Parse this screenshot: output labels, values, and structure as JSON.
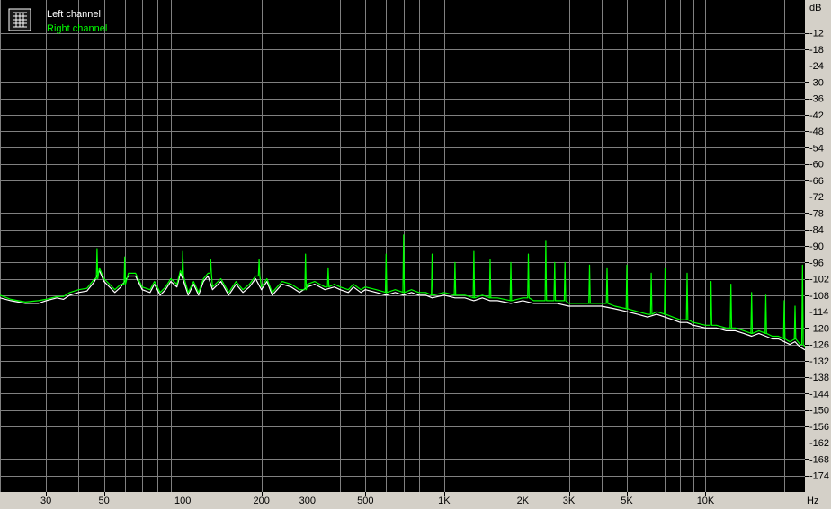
{
  "chart_data": {
    "type": "line",
    "title": "",
    "xlabel": "",
    "ylabel": "",
    "x_unit": "Hz",
    "y_unit": "dB",
    "x_scale": "log",
    "xlim": [
      20,
      24000
    ],
    "ylim": [
      -180,
      0
    ],
    "grid": true,
    "legend_placement": "top-left",
    "background": "#000000",
    "grid_color": "#808080",
    "x_ticks": [
      {
        "value": 30,
        "label": "30"
      },
      {
        "value": 50,
        "label": "50"
      },
      {
        "value": 100,
        "label": "100"
      },
      {
        "value": 200,
        "label": "200"
      },
      {
        "value": 300,
        "label": "300"
      },
      {
        "value": 500,
        "label": "500"
      },
      {
        "value": 1000,
        "label": "1K"
      },
      {
        "value": 2000,
        "label": "2K"
      },
      {
        "value": 3000,
        "label": "3K"
      },
      {
        "value": 5000,
        "label": "5K"
      },
      {
        "value": 10000,
        "label": "10K"
      }
    ],
    "y_ticks": [
      -12,
      -18,
      -24,
      -30,
      -36,
      -42,
      -48,
      -54,
      -60,
      -66,
      -72,
      -78,
      -84,
      -90,
      -96,
      -102,
      -108,
      -114,
      -120,
      -126,
      -132,
      -138,
      -144,
      -150,
      -156,
      -162,
      -168,
      -174
    ],
    "series": [
      {
        "name": "Left channel",
        "color": "#ffffff",
        "x": [
          20,
          22,
          25,
          28,
          30,
          33,
          35,
          37,
          40,
          43,
          46,
          48,
          50,
          55,
          58,
          62,
          66,
          70,
          75,
          78,
          82,
          86,
          90,
          95,
          98,
          100,
          105,
          110,
          115,
          120,
          125,
          130,
          140,
          150,
          160,
          170,
          180,
          190,
          200,
          210,
          220,
          240,
          260,
          280,
          300,
          320,
          350,
          380,
          400,
          430,
          450,
          480,
          500,
          550,
          600,
          650,
          700,
          750,
          800,
          850,
          900,
          1000,
          1100,
          1200,
          1300,
          1400,
          1500,
          1600,
          1800,
          2000,
          2200,
          2500,
          2700,
          3000,
          3300,
          3600,
          4000,
          4500,
          5000,
          5500,
          6000,
          6500,
          7000,
          7500,
          8000,
          8500,
          9000,
          10000,
          11000,
          12000,
          13000,
          14000,
          15000,
          16000,
          17000,
          18000,
          19000,
          20000,
          21000,
          22000,
          23000,
          24000
        ],
        "y": [
          -109,
          -110,
          -111,
          -111,
          -110,
          -109,
          -109.5,
          -108,
          -107,
          -106.5,
          -103,
          -99,
          -103,
          -107,
          -105,
          -101,
          -101,
          -106,
          -107,
          -104,
          -108,
          -106,
          -103,
          -105,
          -100,
          -102,
          -108,
          -104,
          -108,
          -103,
          -101,
          -106,
          -103,
          -108,
          -104,
          -107,
          -105,
          -102,
          -106,
          -103,
          -108,
          -104,
          -105,
          -107,
          -105,
          -104,
          -106,
          -105,
          -106,
          -107,
          -105,
          -107,
          -106,
          -107,
          -108,
          -107,
          -108,
          -107,
          -108,
          -108,
          -109,
          -108,
          -109,
          -109,
          -110,
          -109,
          -110,
          -110,
          -111,
          -110,
          -111,
          -111,
          -111,
          -112,
          -112,
          -112,
          -112,
          -113,
          -114,
          -115,
          -116,
          -115,
          -116,
          -117,
          -118,
          -118,
          -119,
          -120,
          -120,
          -121,
          -121,
          -122,
          -123,
          -122,
          -123,
          -124,
          -124,
          -125,
          -126,
          -125,
          -127,
          -128
        ]
      },
      {
        "name": "Right channel",
        "color": "#00ff00",
        "x": [
          20,
          22,
          25,
          28,
          30,
          33,
          35,
          37,
          40,
          43,
          46,
          48,
          50,
          55,
          58,
          62,
          66,
          70,
          75,
          78,
          82,
          86,
          90,
          95,
          98,
          100,
          105,
          110,
          115,
          120,
          125,
          130,
          140,
          150,
          160,
          170,
          180,
          190,
          200,
          210,
          220,
          240,
          260,
          280,
          300,
          320,
          350,
          380,
          400,
          430,
          450,
          480,
          500,
          550,
          600,
          650,
          700,
          750,
          800,
          850,
          900,
          1000,
          1100,
          1200,
          1300,
          1400,
          1500,
          1600,
          1800,
          2000,
          2200,
          2500,
          2700,
          3000,
          3300,
          3600,
          4000,
          4500,
          5000,
          5500,
          6000,
          6500,
          7000,
          7500,
          8000,
          8500,
          9000,
          10000,
          11000,
          12000,
          13000,
          14000,
          15000,
          16000,
          17000,
          18000,
          19000,
          20000,
          21000,
          22000,
          23000,
          24000
        ],
        "y": [
          -108,
          -109.5,
          -110.5,
          -110,
          -109.5,
          -108.5,
          -108.5,
          -107,
          -106,
          -105.5,
          -102,
          -98,
          -102,
          -106,
          -104,
          -100,
          -100,
          -105,
          -106,
          -103,
          -107,
          -105,
          -102,
          -104,
          -99,
          -101,
          -107,
          -103,
          -107,
          -102,
          -100,
          -105,
          -102,
          -107,
          -103,
          -106,
          -104,
          -101,
          -105,
          -102,
          -107,
          -103,
          -104,
          -106,
          -104,
          -103,
          -105,
          -104,
          -105,
          -106,
          -104,
          -106,
          -105,
          -106,
          -107,
          -106,
          -107,
          -106,
          -107,
          -107,
          -108,
          -107,
          -108,
          -108,
          -109,
          -108,
          -109,
          -109,
          -110,
          -109,
          -110,
          -110,
          -110,
          -111,
          -111,
          -111,
          -111,
          -112,
          -113,
          -114,
          -115,
          -114,
          -115,
          -116,
          -117,
          -117,
          -118,
          -119,
          -119,
          -120,
          -120,
          -121,
          -122,
          -121,
          -122,
          -123,
          -123,
          -124,
          -125,
          -124,
          -126,
          -127
        ]
      }
    ],
    "spikes": [
      {
        "x": 47,
        "y": -91
      },
      {
        "x": 60,
        "y": -94
      },
      {
        "x": 100,
        "y": -92
      },
      {
        "x": 128,
        "y": -95
      },
      {
        "x": 196,
        "y": -95
      },
      {
        "x": 295,
        "y": -93
      },
      {
        "x": 360,
        "y": -98
      },
      {
        "x": 600,
        "y": -93
      },
      {
        "x": 700,
        "y": -86
      },
      {
        "x": 900,
        "y": -93
      },
      {
        "x": 1100,
        "y": -96
      },
      {
        "x": 1300,
        "y": -92
      },
      {
        "x": 1500,
        "y": -95
      },
      {
        "x": 1800,
        "y": -96
      },
      {
        "x": 2100,
        "y": -93
      },
      {
        "x": 2450,
        "y": -88
      },
      {
        "x": 2650,
        "y": -96
      },
      {
        "x": 2900,
        "y": -96
      },
      {
        "x": 3600,
        "y": -97
      },
      {
        "x": 4200,
        "y": -98
      },
      {
        "x": 5000,
        "y": -97
      },
      {
        "x": 6200,
        "y": -100
      },
      {
        "x": 7000,
        "y": -98
      },
      {
        "x": 8500,
        "y": -100
      },
      {
        "x": 10500,
        "y": -103
      },
      {
        "x": 12500,
        "y": -104
      },
      {
        "x": 15000,
        "y": -107
      },
      {
        "x": 17000,
        "y": -108
      },
      {
        "x": 20000,
        "y": -110
      },
      {
        "x": 22000,
        "y": -112
      },
      {
        "x": 23500,
        "y": -97
      }
    ]
  },
  "legend": {
    "items": [
      "Left channel",
      "Right channel"
    ]
  }
}
